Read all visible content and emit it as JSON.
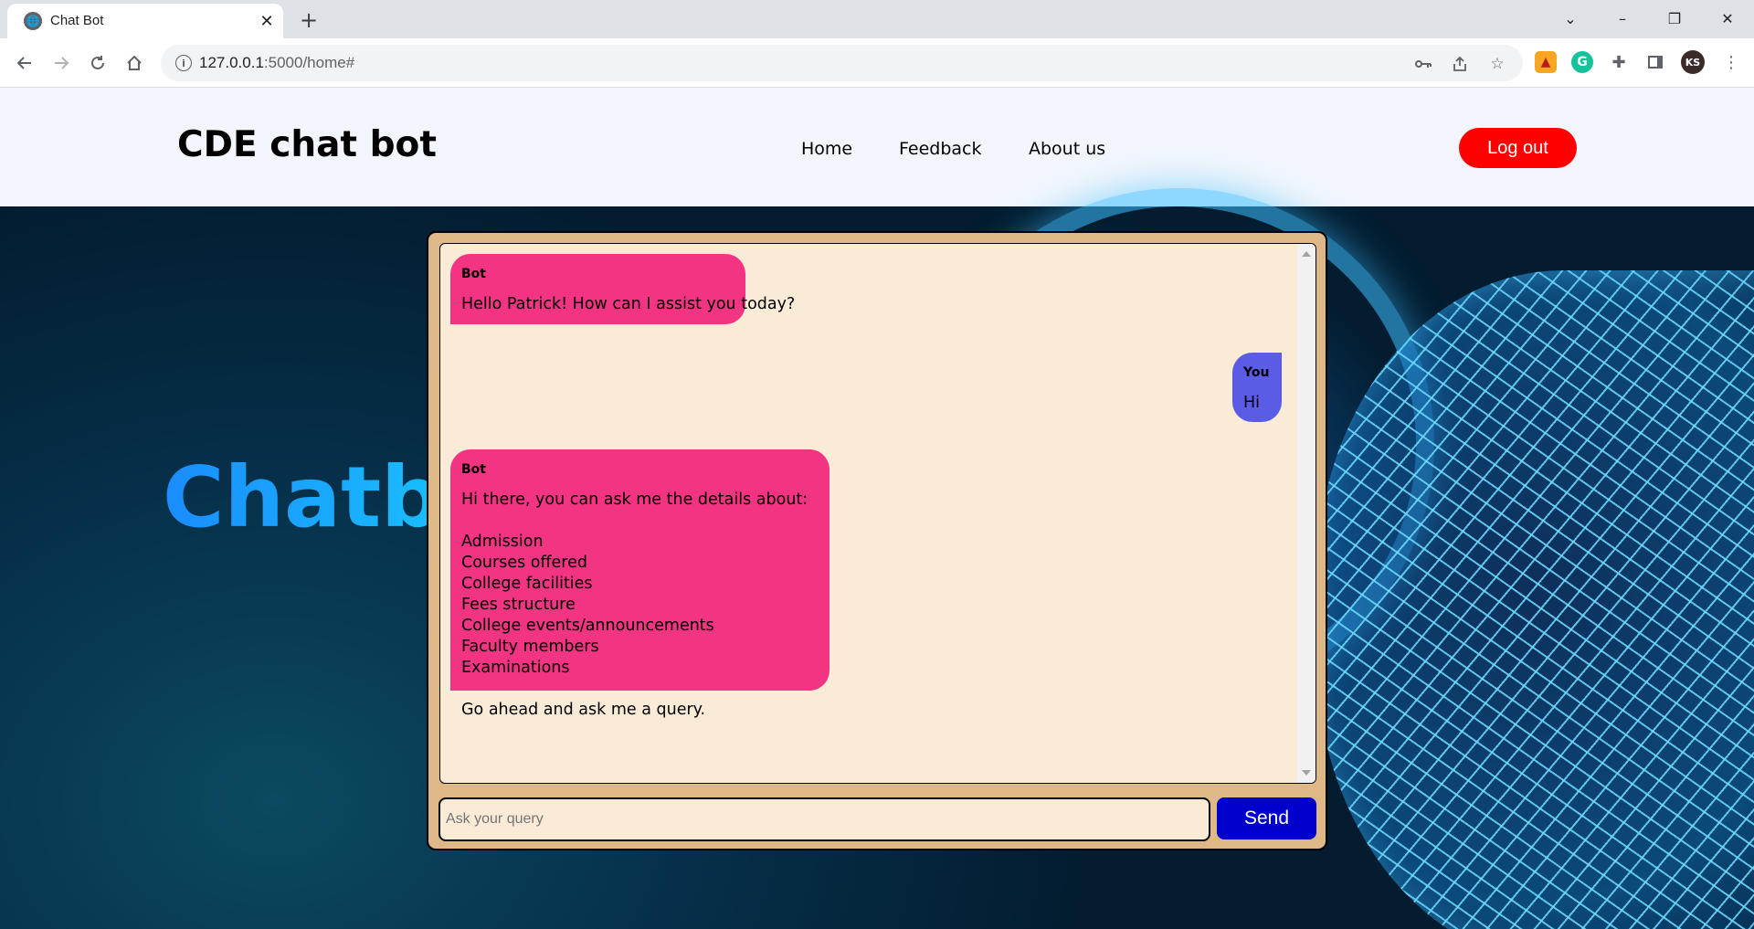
{
  "browser": {
    "tab_title": "Chat Bot",
    "tab_close": "✕",
    "new_tab": "+",
    "url_host": "127.0.0.1",
    "url_rest": ":5000/home#",
    "window_controls": [
      "⌄",
      "–",
      "❐",
      "✕"
    ]
  },
  "header": {
    "brand": "CDE chat bot",
    "nav": [
      "Home",
      "Feedback",
      "About us"
    ],
    "logout_label": "Log out"
  },
  "hero": {
    "title": "Chatbot"
  },
  "chat": {
    "messages": [
      {
        "sender": "Bot",
        "text": "Hello Patrick! How can I assist you today?"
      },
      {
        "sender": "You",
        "text": "Hi"
      },
      {
        "sender": "Bot",
        "text": "Hi there, you can ask me the details about:\n\nAdmission\nCourses offered\nCollege facilities\nFees structure\nCollege events/announcements\nFaculty members\nExaminations\n\nGo ahead and ask me a query."
      }
    ],
    "input_placeholder": "Ask your query",
    "input_value": "",
    "send_label": "Send"
  },
  "colors": {
    "header_bg": "#f2f6fc",
    "logout_bg": "#ff0000",
    "chat_frame": "#deb887",
    "chat_bg": "#faebd7",
    "bot_bubble": "#f23482",
    "user_bubble": "#5b5ce6",
    "send_bg": "#0000cd"
  }
}
